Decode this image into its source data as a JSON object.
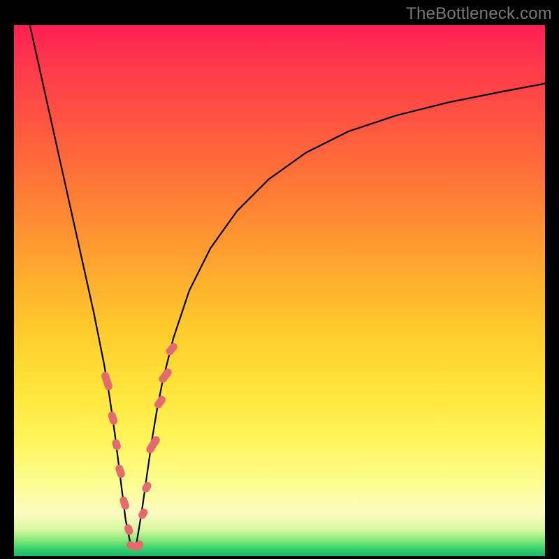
{
  "watermark": "TheBottleneck.com",
  "chart_data": {
    "type": "line",
    "title": "",
    "xlabel": "",
    "ylabel": "",
    "xlim": [
      0,
      100
    ],
    "ylim": [
      0,
      100
    ],
    "legend": false,
    "grid": false,
    "curve": {
      "minimum_x": 22,
      "x": [
        3,
        5,
        7,
        9,
        11,
        13,
        15,
        16,
        17,
        18,
        19,
        20,
        21,
        22,
        23,
        24,
        25,
        26,
        27,
        28,
        30,
        33,
        37,
        42,
        48,
        55,
        63,
        72,
        82,
        92,
        100
      ],
      "y": [
        100,
        91,
        82,
        73,
        64,
        55,
        46,
        41,
        36,
        30,
        23,
        15,
        7,
        2,
        2,
        8,
        15,
        22,
        28,
        33,
        41,
        50,
        58,
        65,
        71,
        76,
        80,
        83,
        85.5,
        87.5,
        89
      ]
    },
    "markers": {
      "color": "#e46a6f",
      "shape": "rounded-capsule",
      "points": [
        {
          "x": 17.5,
          "y": 33,
          "len": 5,
          "angle": 72
        },
        {
          "x": 18.6,
          "y": 26,
          "len": 3,
          "angle": 72
        },
        {
          "x": 19.3,
          "y": 21,
          "len": 2,
          "angle": 72
        },
        {
          "x": 20.0,
          "y": 16,
          "len": 3,
          "angle": 72
        },
        {
          "x": 20.8,
          "y": 10,
          "len": 3,
          "angle": 72
        },
        {
          "x": 21.6,
          "y": 5,
          "len": 2,
          "angle": 72
        },
        {
          "x": 22.2,
          "y": 2,
          "len": 2,
          "angle": 20
        },
        {
          "x": 23.5,
          "y": 2,
          "len": 2,
          "angle": -60
        },
        {
          "x": 24.3,
          "y": 8,
          "len": 2,
          "angle": -60
        },
        {
          "x": 25.0,
          "y": 13,
          "len": 2,
          "angle": -60
        },
        {
          "x": 26.2,
          "y": 21,
          "len": 5,
          "angle": -58
        },
        {
          "x": 27.5,
          "y": 29,
          "len": 3,
          "angle": -55
        },
        {
          "x": 28.5,
          "y": 34,
          "len": 4,
          "angle": -52
        },
        {
          "x": 29.7,
          "y": 39,
          "len": 3,
          "angle": -50
        }
      ]
    }
  }
}
